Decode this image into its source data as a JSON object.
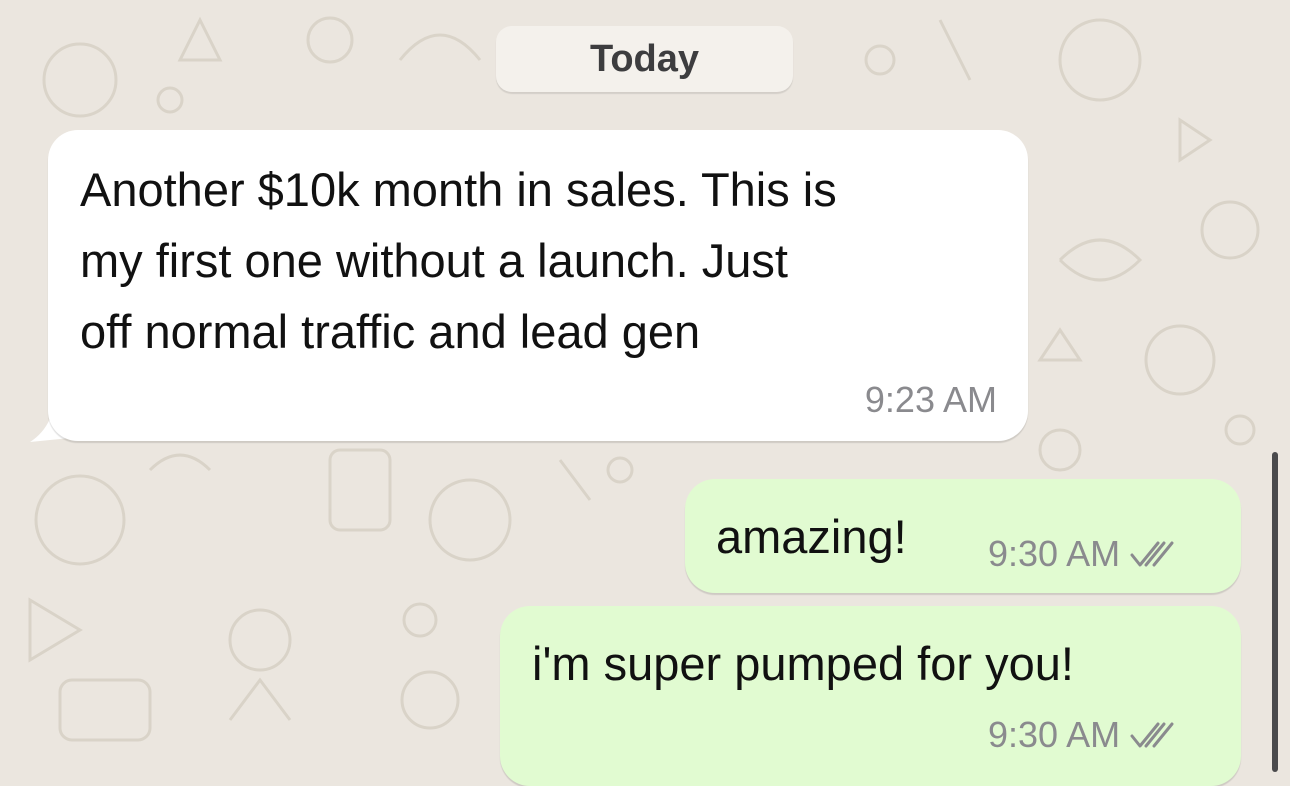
{
  "date_divider": "Today",
  "messages": [
    {
      "direction": "incoming",
      "lines": [
        "Another $10k month in sales. This is",
        "my first one without a launch. Just",
        "off normal traffic and lead gen"
      ],
      "time": "9:23 AM"
    },
    {
      "direction": "outgoing",
      "text": "amazing!",
      "time": "9:30 AM",
      "status_icon": "double-check-icon"
    },
    {
      "direction": "outgoing",
      "text": "i'm super pumped for you!",
      "time": "9:30 AM",
      "status_icon": "double-check-icon"
    }
  ],
  "colors": {
    "background": "#ebe6df",
    "incoming_bubble": "#ffffff",
    "outgoing_bubble": "#e1fbd1",
    "timestamp": "#8a8a8e"
  }
}
